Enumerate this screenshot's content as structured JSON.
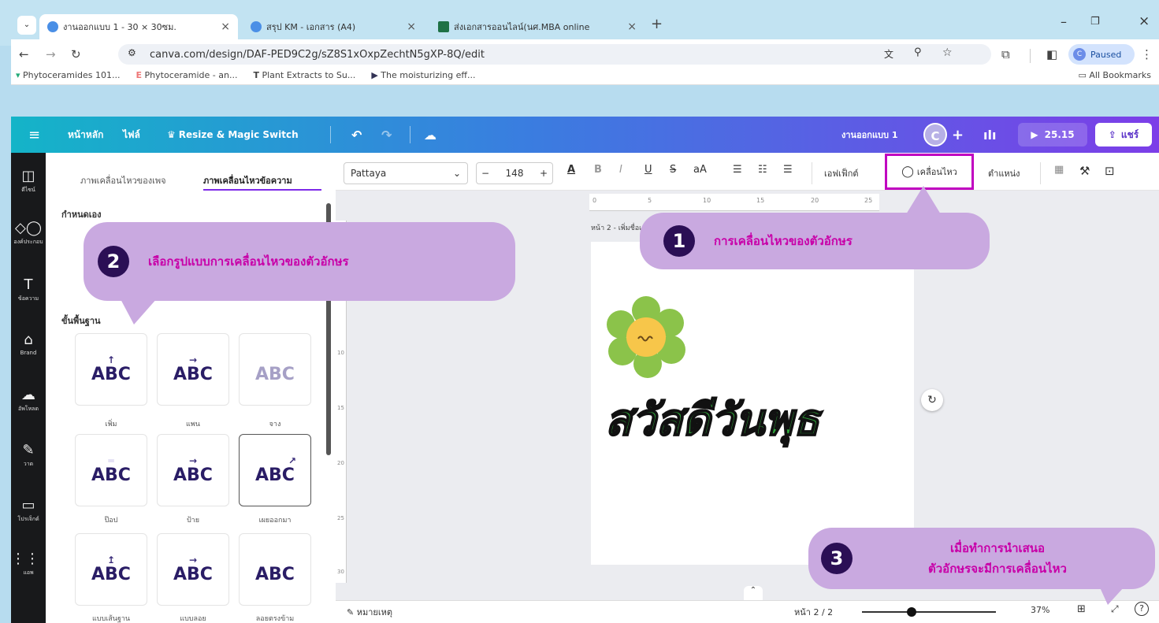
{
  "browser": {
    "tabs": [
      {
        "title": "งานออกแบบ 1 - 30 × 30ซม."
      },
      {
        "title": "สรุป KM - เอกสาร (A4)"
      },
      {
        "title": "ส่งเอกสารออนไลน์(นศ.MBA online"
      }
    ],
    "url": "canva.com/design/DAF-PED9C2g/sZ8S1xOxpZechtN5gXP-8Q/edit",
    "profile_status": "Paused",
    "profile_initial": "C",
    "bookmarks": [
      "Phytoceramides 101...",
      "Phytoceramide - an...",
      "Plant Extracts to Su...",
      "The moisturizing eff..."
    ],
    "all_bookmarks": "All Bookmarks"
  },
  "canva": {
    "menu": {
      "home": "หน้าหลัก",
      "file": "ไฟล์",
      "resize": "Resize & Magic Switch"
    },
    "design_name": "งานออกแบบ 1",
    "user_initial": "C",
    "present_time": "25.15",
    "share": "แชร์",
    "rail": [
      "ดีไซน์",
      "องค์ประกอบ",
      "ข้อความ",
      "Brand",
      "อัพโหลด",
      "วาด",
      "โปรเจ็กต์",
      "แอพ"
    ],
    "panel": {
      "tab_page": "ภาพเคลื่อนไหวของเพจ",
      "tab_text": "ภาพเคลื่อนไหวข้อความ",
      "custom": "กำหนดเอง",
      "basic": "ขั้นพื้นฐาน",
      "sample": "ABC",
      "cards": [
        "เพิ่ม",
        "แพน",
        "จาง",
        "ป๊อป",
        "ป้าย",
        "เผยออกมา",
        "แบบเส้นฐาน",
        "แบบลอย",
        "ลอยตรงข้าม"
      ]
    },
    "toolbar": {
      "font": "Pattaya",
      "size": "148",
      "effects": "เอฟเฟ็กต์",
      "animate": "เคลื่อนไหว",
      "position": "ตำแหน่ง"
    },
    "ruler": [
      "0",
      "5",
      "10",
      "15",
      "20",
      "25"
    ],
    "vruler": [
      "10",
      "15",
      "20",
      "25",
      "30"
    ],
    "page_label": "หน้า 2 - เพิ่มชื่อเพจ",
    "canvas_text": "สวัสดีวันพุธ",
    "footer": {
      "notes": "หมายเหตุ",
      "page": "หน้า 2 / 2",
      "zoom": "37%"
    }
  },
  "callouts": [
    {
      "num": "1",
      "text": "การเคลื่อนไหวของตัวอักษร"
    },
    {
      "num": "2",
      "text": "เลือกรูปแบบการเคลื่อนไหวของตัวอักษร"
    },
    {
      "num": "3",
      "line1": "เมื่อทำการนำเสนอ",
      "line2": "ตัวอักษรจะมีการเคลื่อนไหว"
    }
  ],
  "colors": {
    "callout_bg": "#c9a9e0",
    "callout_text": "#c800a8",
    "highlight": "#c000c0",
    "canvas_text": "#2fa83a"
  }
}
